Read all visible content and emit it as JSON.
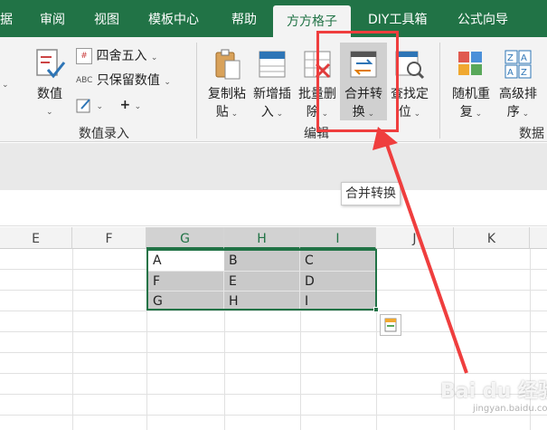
{
  "tabs": [
    {
      "label": "据",
      "active": false
    },
    {
      "label": "审阅",
      "active": false
    },
    {
      "label": "视图",
      "active": false
    },
    {
      "label": "模板中心",
      "active": false
    },
    {
      "label": "帮助",
      "active": false
    },
    {
      "label": "方方格子",
      "active": true
    },
    {
      "label": "DIY工具箱",
      "active": false
    },
    {
      "label": "公式向导",
      "active": false
    },
    {
      "label": "",
      "active": false
    }
  ],
  "ribbon": {
    "numeric": {
      "big_button": {
        "line1": "数值",
        "icon": "numeric-check-icon"
      },
      "rows": [
        {
          "label": "四舍五入",
          "icon": "round-icon"
        },
        {
          "label": "只保留数值",
          "prefix": "ABC",
          "icon": "abc-icon"
        },
        {
          "label": "+",
          "icon": "edit-pen-icon"
        }
      ],
      "group_label": "数值录入"
    },
    "edit": {
      "buttons": [
        {
          "line1": "复制粘",
          "line2": "贴",
          "icon": "clipboard-icon"
        },
        {
          "line1": "新增插",
          "line2": "入",
          "icon": "insert-row-icon"
        },
        {
          "line1": "批量删",
          "line2": "除",
          "icon": "delete-icon"
        },
        {
          "line1": "合并转",
          "line2": "换",
          "icon": "merge-convert-icon"
        },
        {
          "line1": "查找定",
          "line2": "位",
          "icon": "find-locate-icon"
        }
      ],
      "group_label": "编辑"
    },
    "data": {
      "buttons": [
        {
          "line1": "随机重",
          "line2": "复",
          "icon": "random-icon"
        },
        {
          "line1": "高级排",
          "line2": "序",
          "icon": "sort-icon"
        }
      ],
      "group_label": "数据"
    }
  },
  "tooltip": "合并转换",
  "columns": [
    "E",
    "F",
    "G",
    "H",
    "I",
    "J",
    "K"
  ],
  "cells": [
    [
      "A",
      "B",
      "C"
    ],
    [
      "F",
      "E",
      "D"
    ],
    [
      "G",
      "H",
      "I"
    ]
  ],
  "watermark": "Bai du 经验",
  "watermark_sub": "jingyan.baidu.com",
  "colors": {
    "accent": "#217346",
    "annotation": "#ef3e3e"
  }
}
